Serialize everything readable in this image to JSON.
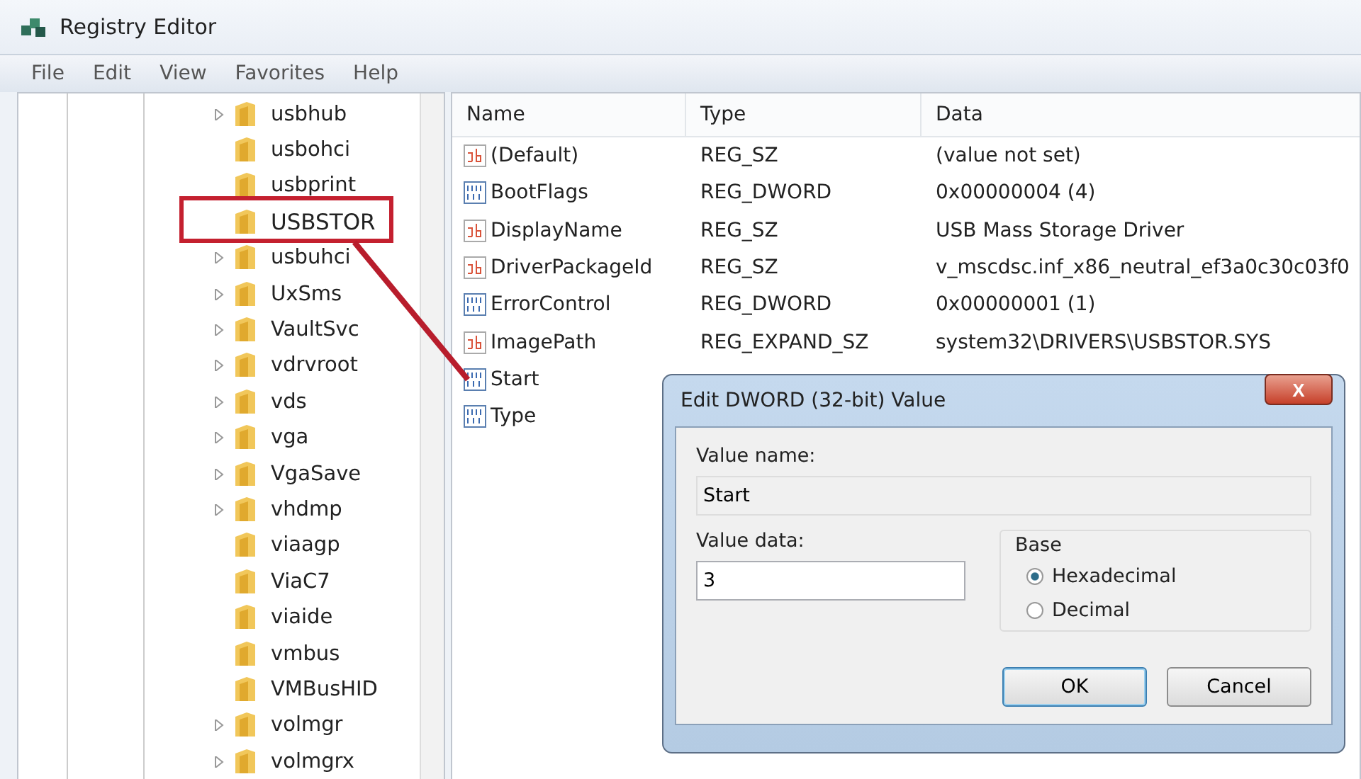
{
  "window": {
    "title": "Registry Editor"
  },
  "menu": [
    "File",
    "Edit",
    "View",
    "Favorites",
    "Help"
  ],
  "tree": {
    "items": [
      {
        "label": "usbhub",
        "expandable": true,
        "selected": false
      },
      {
        "label": "usbohci",
        "expandable": false,
        "selected": false
      },
      {
        "label": "usbprint",
        "expandable": false,
        "selected": false
      },
      {
        "label": "USBSTOR",
        "expandable": false,
        "selected": true
      },
      {
        "label": "usbuhci",
        "expandable": true,
        "selected": false
      },
      {
        "label": "UxSms",
        "expandable": true,
        "selected": false
      },
      {
        "label": "VaultSvc",
        "expandable": true,
        "selected": false
      },
      {
        "label": "vdrvroot",
        "expandable": true,
        "selected": false
      },
      {
        "label": "vds",
        "expandable": true,
        "selected": false
      },
      {
        "label": "vga",
        "expandable": true,
        "selected": false
      },
      {
        "label": "VgaSave",
        "expandable": true,
        "selected": false
      },
      {
        "label": "vhdmp",
        "expandable": true,
        "selected": false
      },
      {
        "label": "viaagp",
        "expandable": false,
        "selected": false
      },
      {
        "label": "ViaC7",
        "expandable": false,
        "selected": false
      },
      {
        "label": "viaide",
        "expandable": false,
        "selected": false
      },
      {
        "label": "vmbus",
        "expandable": false,
        "selected": false
      },
      {
        "label": "VMBusHID",
        "expandable": false,
        "selected": false
      },
      {
        "label": "volmgr",
        "expandable": true,
        "selected": false
      },
      {
        "label": "volmgrx",
        "expandable": true,
        "selected": false
      }
    ]
  },
  "values": {
    "columns": [
      "Name",
      "Type",
      "Data"
    ],
    "rows": [
      {
        "kind": "string",
        "name": "(Default)",
        "type": "REG_SZ",
        "data": "(value not set)"
      },
      {
        "kind": "binary",
        "name": "BootFlags",
        "type": "REG_DWORD",
        "data": "0x00000004 (4)"
      },
      {
        "kind": "string",
        "name": "DisplayName",
        "type": "REG_SZ",
        "data": "USB Mass Storage Driver"
      },
      {
        "kind": "string",
        "name": "DriverPackageId",
        "type": "REG_SZ",
        "data": "v_mscdsc.inf_x86_neutral_ef3a0c30c03f0"
      },
      {
        "kind": "binary",
        "name": "ErrorControl",
        "type": "REG_DWORD",
        "data": "0x00000001 (1)"
      },
      {
        "kind": "string",
        "name": "ImagePath",
        "type": "REG_EXPAND_SZ",
        "data": "system32\\DRIVERS\\USBSTOR.SYS"
      },
      {
        "kind": "binary",
        "name": "Start"
      },
      {
        "kind": "binary",
        "name": "Type"
      }
    ]
  },
  "dialog": {
    "title": "Edit DWORD (32-bit) Value",
    "close": "X",
    "value_name_label": "Value name:",
    "value_name": "Start",
    "value_data_label": "Value data:",
    "value_data": "3",
    "base_label": "Base",
    "bases": [
      {
        "label": "Hexadecimal",
        "selected": true
      },
      {
        "label": "Decimal",
        "selected": false
      }
    ],
    "buttons": [
      "OK",
      "Cancel"
    ]
  }
}
